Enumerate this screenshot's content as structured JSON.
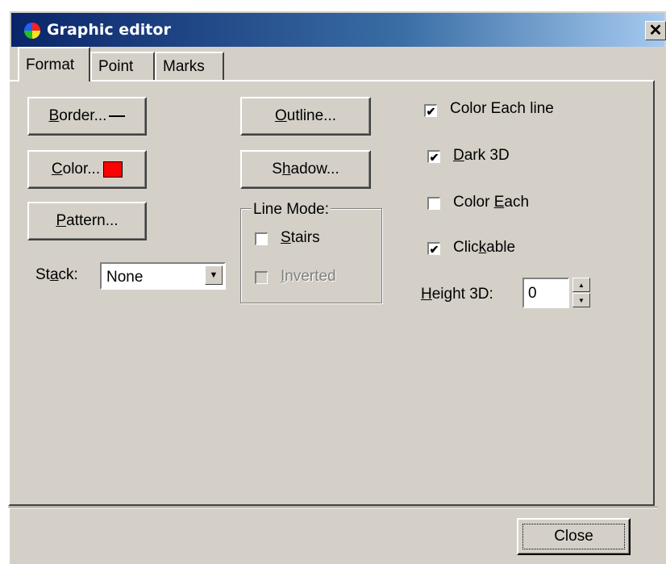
{
  "window": {
    "title": "Graphic editor",
    "close_glyph": "✕"
  },
  "tabs": [
    {
      "label": "Format",
      "active": true
    },
    {
      "label": "Point",
      "active": false
    },
    {
      "label": "Marks",
      "active": false
    }
  ],
  "format": {
    "border_button": {
      "mnemonic": "B",
      "rest": "order..."
    },
    "color_button": {
      "mnemonic": "C",
      "rest": "olor...",
      "swatch_color": "#ff0000"
    },
    "pattern_button": {
      "mnemonic": "P",
      "rest": "attern..."
    },
    "stack": {
      "label_before": "St",
      "mnemonic": "a",
      "label_after": "ck:",
      "value": "None"
    },
    "outline_button": {
      "mnemonic": "O",
      "rest": "utline..."
    },
    "shadow_button": {
      "before": "S",
      "mnemonic": "h",
      "rest": "adow..."
    },
    "line_mode": {
      "title": "Line Mode:",
      "stairs": {
        "mnemonic": "S",
        "rest": "tairs",
        "checked": false
      },
      "inverted": {
        "mnemonic": "I",
        "rest": "nverted",
        "checked": false,
        "disabled": true
      }
    },
    "color_each_line": {
      "label": "Color Each line",
      "checked": true
    },
    "dark_3d": {
      "mnemonic": "D",
      "rest": "ark 3D",
      "checked": true
    },
    "color_each": {
      "before": "Color ",
      "mnemonic": "E",
      "rest": "ach",
      "checked": false
    },
    "clickable": {
      "before": "Clic",
      "mnemonic": "k",
      "rest": "able",
      "checked": true
    },
    "height_3d": {
      "mnemonic": "H",
      "rest": "eight 3D:",
      "value": "0"
    }
  },
  "footer": {
    "close_label": "Close"
  }
}
